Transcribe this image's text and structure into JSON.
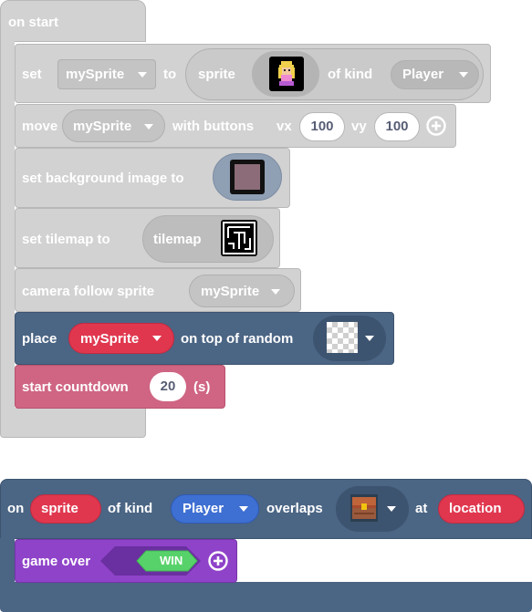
{
  "start_hat": {
    "label": "on start"
  },
  "set_block": {
    "set_label": "set",
    "variable": "mySprite",
    "to_label": "to",
    "sprite_label": "sprite",
    "of_kind_label": "of kind",
    "kind": "Player"
  },
  "move_block": {
    "move_label": "move",
    "variable": "mySprite",
    "with_buttons_label": "with buttons",
    "vx_label": "vx",
    "vx_value": "100",
    "vy_label": "vy",
    "vy_value": "100"
  },
  "bg_block": {
    "label": "set background image to"
  },
  "tilemap_block": {
    "label": "set tilemap to",
    "tilemap_label": "tilemap"
  },
  "camera_block": {
    "label": "camera follow sprite",
    "variable": "mySprite"
  },
  "place_block": {
    "place_label": "place",
    "variable": "mySprite",
    "on_top_label": "on top of random"
  },
  "countdown_block": {
    "label": "start countdown",
    "value": "20",
    "unit": "(s)"
  },
  "overlap_hat": {
    "on_label": "on",
    "sprite_param": "sprite",
    "of_kind_label": "of kind",
    "kind": "Player",
    "overlaps_label": "overlaps",
    "at_label": "at",
    "location_param": "location"
  },
  "gameover_block": {
    "label": "game over",
    "win_value": "WIN"
  },
  "colors": {
    "disabled_block": "#d2d2d2",
    "scene_blue": "#4b6584",
    "sprites_red": "#e0374f",
    "info_pink": "#cf6583",
    "kind_blue": "#3e6fd2",
    "game_purple": "#8f43c9",
    "boolean_green": "#57d26a"
  }
}
